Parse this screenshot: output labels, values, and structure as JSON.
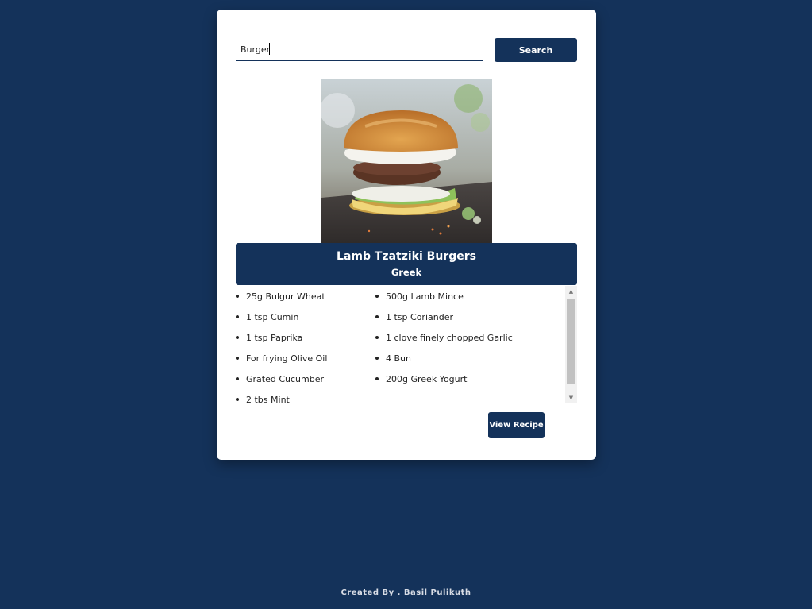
{
  "search": {
    "value": "Burger",
    "button_label": "Search"
  },
  "recipe": {
    "image_icon": "burger-photo",
    "title": "Lamb Tzatziki Burgers",
    "cuisine": "Greek",
    "ingredients": [
      "25g Bulgur Wheat",
      "500g Lamb Mince",
      "1 tsp Cumin",
      "1 tsp Coriander",
      "1 tsp Paprika",
      "1 clove finely chopped Garlic",
      "For frying Olive Oil",
      "4 Bun",
      "Grated Cucumber",
      "200g Greek Yogurt",
      "2 tbs Mint"
    ],
    "view_button_label": "View Recipe"
  },
  "footer": {
    "credit": "Created By . Basil Pulikuth"
  },
  "colors": {
    "background": "#14325a",
    "accent": "#14325a",
    "card": "#ffffff"
  }
}
